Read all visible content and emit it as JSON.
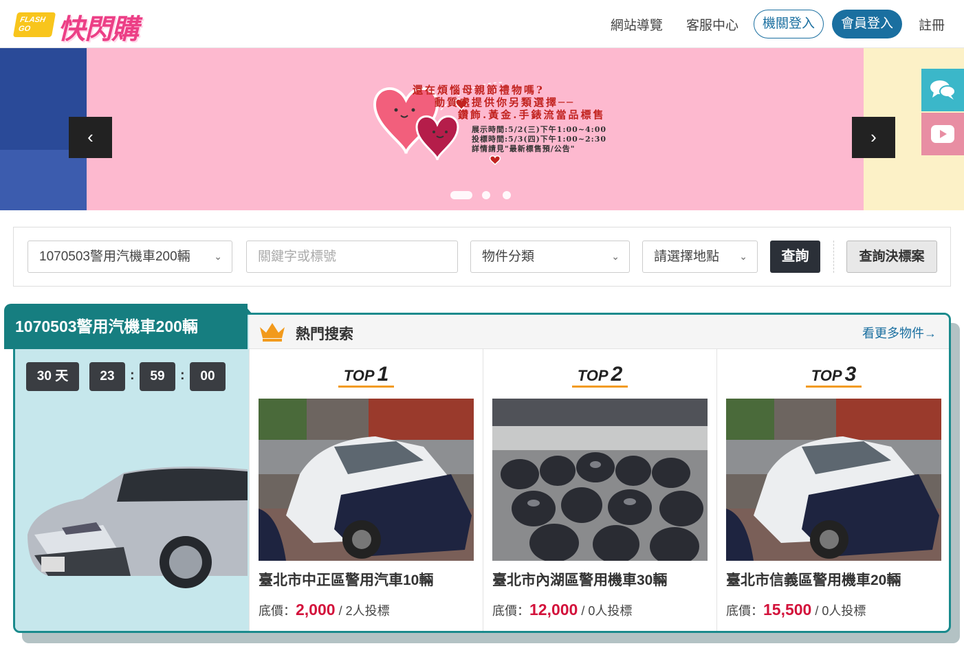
{
  "header": {
    "logo_badge": "FLASH GO",
    "logo_text": "快閃購",
    "nav": [
      "網站導覽",
      "客服中心"
    ],
    "org_login": "機關登入",
    "member_login": "會員登入",
    "register": "註冊"
  },
  "banner": {
    "line1": "還在煩惱母親節禮物嗎?",
    "line2": "動質處提供你另類選擇──",
    "line3": "鑽飾.黃金.手錶流當品標售",
    "line4": "展示時間:5/2(三)下午1:00~4:00",
    "line5": "投標時間:5/3(四)下午1:00~2:30",
    "line6": "詳情請見\"最新標售預/公告\"",
    "prev": "‹",
    "next": "›",
    "slides": 3,
    "active_slide": 1
  },
  "search": {
    "event_value": "1070503警用汽機車200輛",
    "keyword_placeholder": "關鍵字或標號",
    "category_value": "物件分類",
    "location_value": "請選擇地點",
    "query_button": "查詢",
    "results_button": "查詢決標案"
  },
  "event": {
    "title": "1070503警用汽機車200輛",
    "days": "30 天",
    "hours": "23",
    "minutes": "59",
    "seconds": "00",
    "sep": ":"
  },
  "hot": {
    "title": "熱門搜索",
    "more": "看更多物件→",
    "items": [
      {
        "rank_label": "TOP",
        "rank": "1",
        "name": "臺北市中正區警用汽車10輛",
        "price_label": "底價：",
        "price": "2,000",
        "bids": "/ 2人投標"
      },
      {
        "rank_label": "TOP",
        "rank": "2",
        "name": "臺北市內湖區警用機車30輛",
        "price_label": "底價：",
        "price": "12,000",
        "bids": "/ 0人投標"
      },
      {
        "rank_label": "TOP",
        "rank": "3",
        "name": "臺北市信義區警用機車20輛",
        "price_label": "底價：",
        "price": "15,500",
        "bids": "/ 0人投標"
      }
    ]
  },
  "colors": {
    "brand_blue": "#1a6fa0",
    "teal": "#167e80",
    "price_red": "#d3123b",
    "logo_pink": "#ec3f86"
  }
}
